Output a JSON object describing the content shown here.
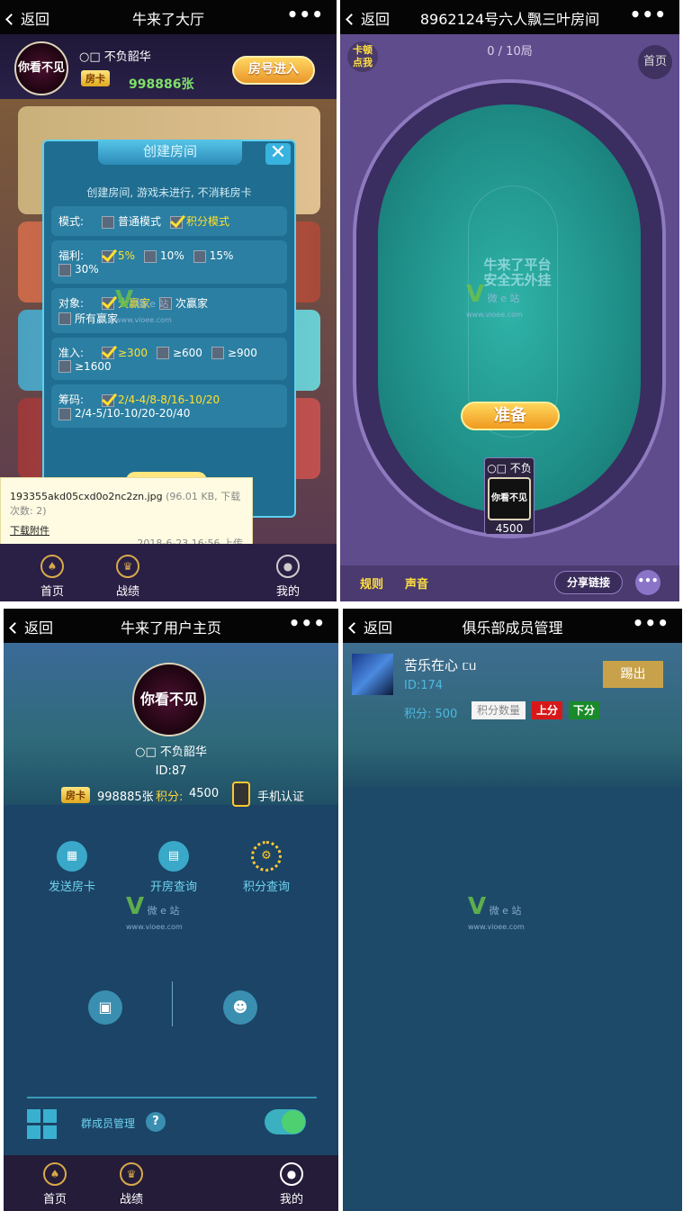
{
  "panel1": {
    "back": "返回",
    "title": "牛来了大厅",
    "more": "•••",
    "avatar_text": "你看不见",
    "username": "○□ 不负韶华",
    "card_label": "房卡",
    "card_count": "998886张",
    "join_button": "房号进入",
    "dialog": {
      "title": "创建房间",
      "subtitle": "创建房间, 游戏未进行, 不消耗房卡",
      "rows": [
        {
          "label": "模式:",
          "options": [
            {
              "text": "普通模式",
              "checked": false
            },
            {
              "text": "积分模式",
              "checked": true
            }
          ]
        },
        {
          "label": "福利:",
          "options": [
            {
              "text": "5%",
              "checked": true
            },
            {
              "text": "10%",
              "checked": false
            },
            {
              "text": "15%",
              "checked": false
            },
            {
              "text": "30%",
              "checked": false
            }
          ]
        },
        {
          "label": "对象:",
          "options": [
            {
              "text": "大赢家",
              "checked": true
            },
            {
              "text": "次赢家",
              "checked": false
            },
            {
              "text": "所有赢家",
              "checked": false
            }
          ]
        },
        {
          "label": "准入:",
          "options": [
            {
              "text": "≥300",
              "checked": true
            },
            {
              "text": "≥600",
              "checked": false
            },
            {
              "text": "≥900",
              "checked": false
            },
            {
              "text": "≥1600",
              "checked": false
            }
          ]
        },
        {
          "label": "筹码:",
          "options": [
            {
              "text": "2/4-4/8-8/16-10/20",
              "checked": true
            },
            {
              "text": "2/4-5/10-10/20-20/40",
              "checked": false
            }
          ]
        }
      ]
    },
    "tooltip": {
      "filename": "193355akd05cxd0o2nc2zn.jpg",
      "meta": "(96.01 KB, 下载次数: 2)",
      "link": "下载附件",
      "date": "2018-6-23 16:56 上传"
    },
    "tabs": [
      "首页",
      "战绩",
      "我的"
    ]
  },
  "panel2": {
    "back": "返回",
    "title": "8962124号六人飘三叶房间",
    "more": "•••",
    "lag_line1": "卡顿",
    "lag_line2": "点我",
    "rounds": "0 / 10局",
    "home": "首页",
    "table_logo_line1": "牛来了平台",
    "table_logo_line2": "安全无外挂",
    "ready": "准备",
    "player_name": "○□ 不负",
    "player_avatar": "你看不见",
    "player_score": "4500",
    "rules": "规则",
    "sound": "声音",
    "share": "分享链接",
    "chat_icon": "•••"
  },
  "panel3": {
    "back": "返回",
    "title": "牛来了用户主页",
    "more": "•••",
    "avatar_text": "你看不见",
    "username": "○□ 不负韶华",
    "id": "ID:87",
    "card_label": "房卡",
    "card_count": "998885张",
    "points_label": "积分:",
    "points": "4500",
    "phone": "手机认证",
    "actions": [
      "发送房卡",
      "开房查询",
      "积分查询"
    ],
    "group_label": "群成员管理",
    "help": "?",
    "tabs": [
      "首页",
      "战绩",
      "我的"
    ]
  },
  "panel4": {
    "back": "返回",
    "title": "俱乐部成员管理",
    "more": "•••",
    "member_name": "苦乐在心 ᥴᥙ",
    "member_id": "ID:174",
    "kick": "踢出",
    "points_label": "积分: 500",
    "points_qty": "积分数量",
    "up": "上分",
    "down": "下分"
  },
  "watermark": {
    "brand": "V",
    "text1": "微 e 站",
    "text2": "www.vioee.com"
  }
}
